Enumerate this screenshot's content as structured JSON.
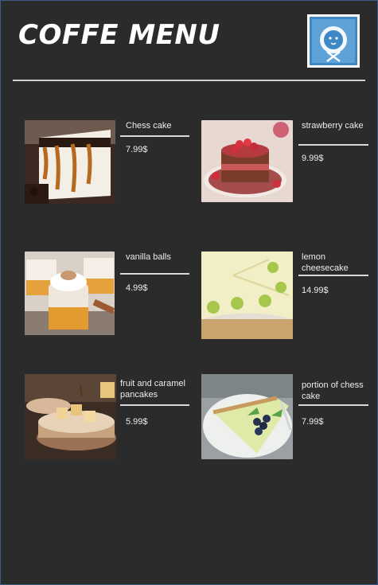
{
  "header": {
    "title": "COFFE MENU",
    "logo_icon": "white-lion-fork-knife-logo",
    "accent_color": "#3f88c5"
  },
  "menu": {
    "items": [
      {
        "name": "Chess cake",
        "price": "7.99$",
        "image": "cheesecake-slice-caramel-photo"
      },
      {
        "name": "strawberry cake",
        "price": "9.99$",
        "image": "strawberry-mousse-cake-photo"
      },
      {
        "name": "vanilla balls",
        "price": "4.99$",
        "image": "vanilla-dessert-jars-photo"
      },
      {
        "name": "lemon cheesecake",
        "price": "14.99$",
        "image": "key-lime-cheesecake-photo"
      },
      {
        "name": "fruit and caramel pancakes",
        "price": "5.99$",
        "image": "pear-caramel-tart-photo"
      },
      {
        "name": "portion of chess cake",
        "price": "7.99$",
        "image": "lime-pie-slice-blueberries-photo"
      }
    ]
  }
}
